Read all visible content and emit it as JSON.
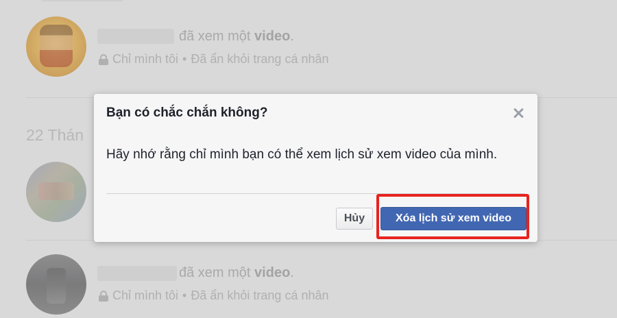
{
  "feed": {
    "items": [
      {
        "action_prefix": "đã xem một",
        "action_object": "video",
        "action_suffix": ".",
        "privacy": "Chỉ mình tôi",
        "separator": "•",
        "visibility": "Đã ẩn khỏi trang cá nhân"
      },
      {
        "action_prefix": "đã xem một",
        "action_object": "video",
        "action_suffix": ".",
        "privacy": "Chỉ mình tôi",
        "separator": "•",
        "visibility": "Đã ẩn khỏi trang cá nhân"
      }
    ],
    "date_heading": "22 Thán"
  },
  "dialog": {
    "title": "Bạn có chắc chắn không?",
    "message": "Hãy nhớ rằng chỉ mình bạn có thể xem lịch sử xem video của mình.",
    "cancel_label": "Hủy",
    "confirm_label": "Xóa lịch sử xem video",
    "close_icon": "close-icon"
  },
  "colors": {
    "accent": "#4267b2",
    "highlight": "#e8231f"
  }
}
